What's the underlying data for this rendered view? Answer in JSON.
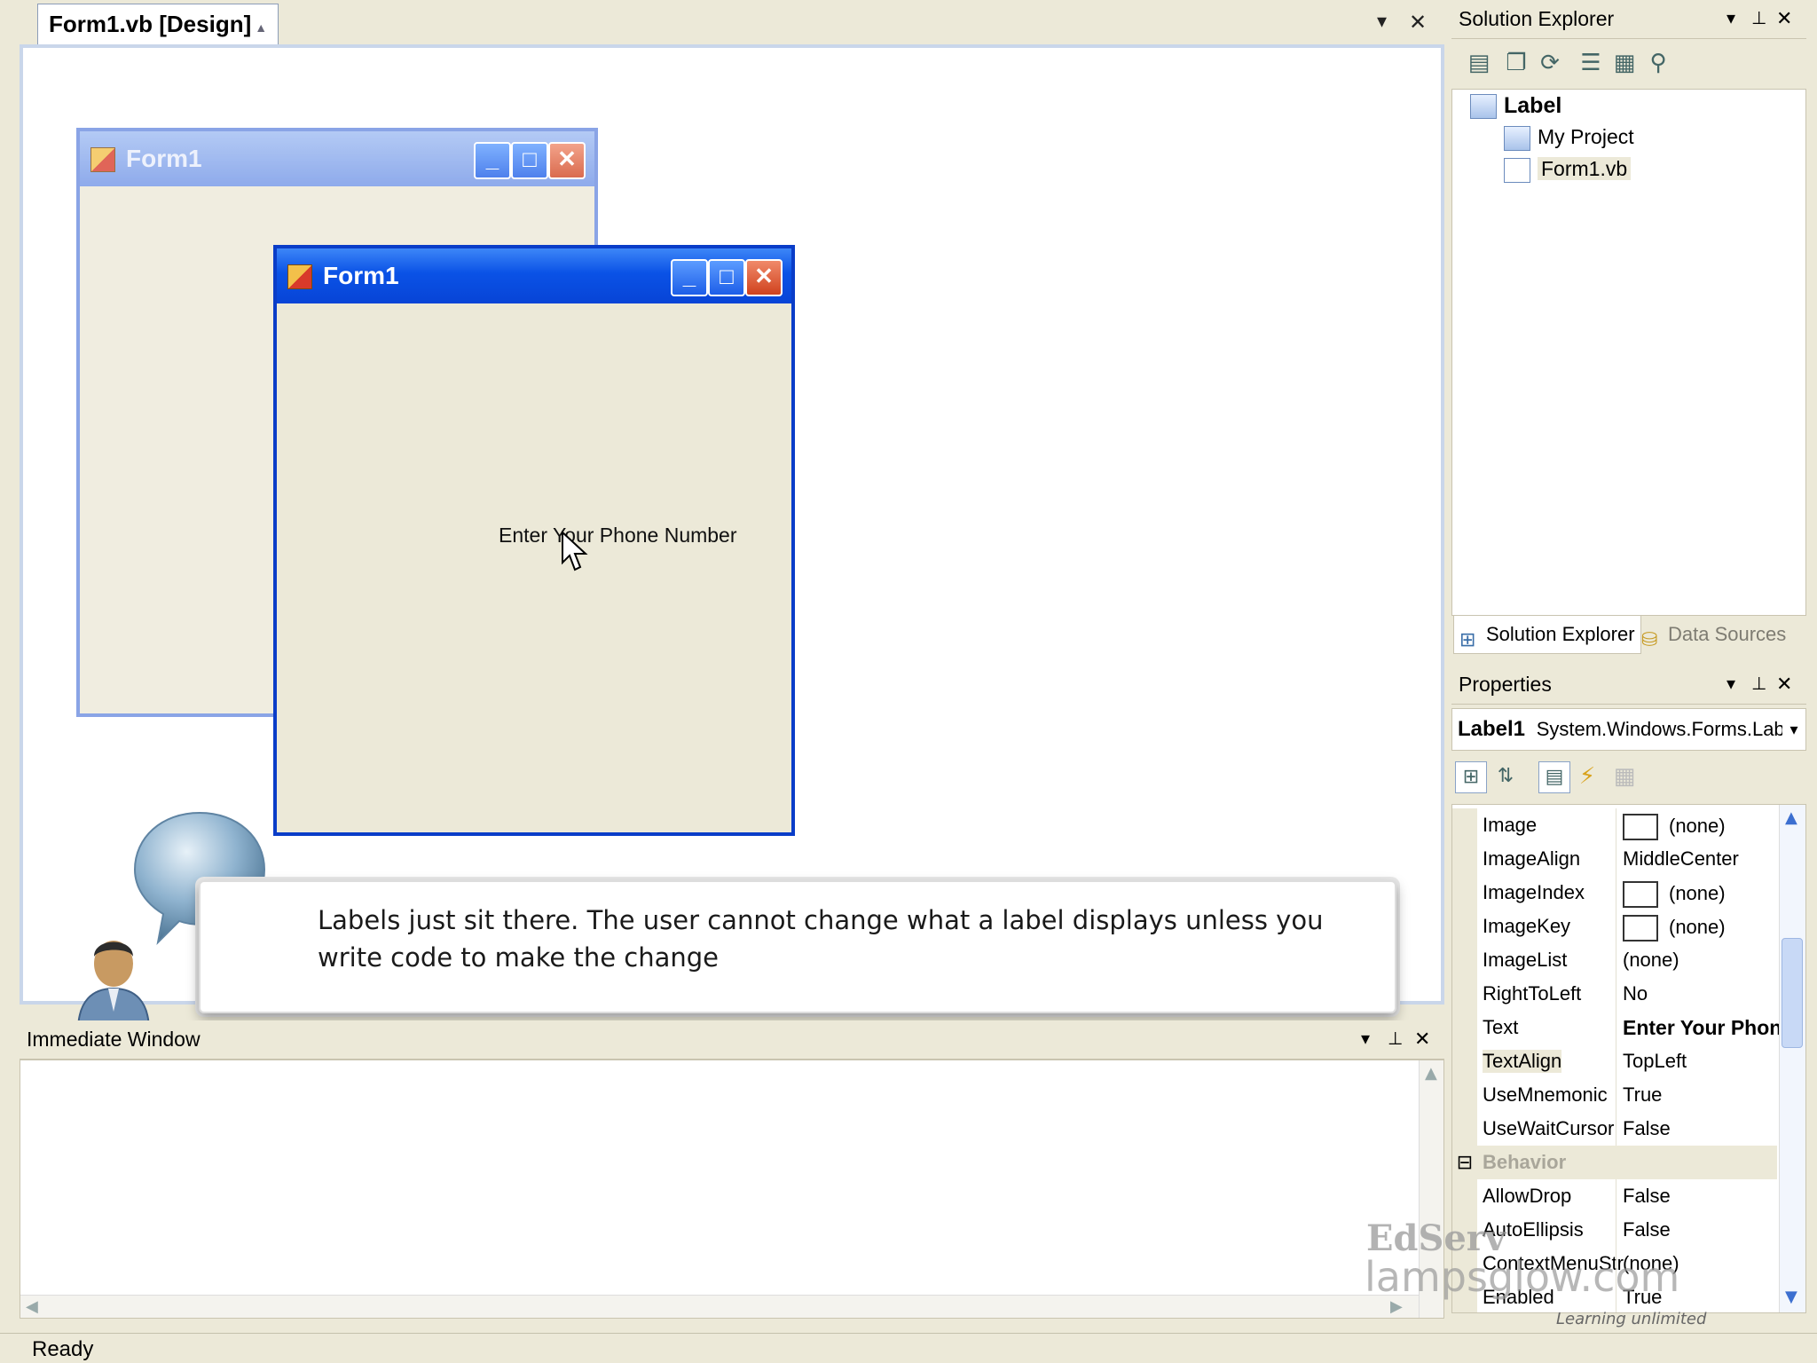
{
  "document": {
    "tab_title": "Form1.vb [Design]",
    "pin_glyph": "▲",
    "dropdown_glyph": "▾",
    "close_glyph": "✕"
  },
  "forms": {
    "back_title": "Form1",
    "front_title": "Form1",
    "label_text": "Enter Your Phone Number",
    "minimize_glyph": "_",
    "maximize_glyph": "□",
    "close_glyph": "✕"
  },
  "callout": {
    "text": "Labels just sit there. The user cannot change what a label displays unless you write code to make the change"
  },
  "immediate_window": {
    "title": "Immediate Window"
  },
  "status": {
    "text": "Ready"
  },
  "solution_explorer": {
    "title": "Solution Explorer",
    "toolbar_icons": [
      "properties-icon",
      "show-all-files-icon",
      "refresh-icon",
      "view-code-icon",
      "view-designer-icon",
      "class-diagram-icon"
    ],
    "tree": [
      {
        "label": "Label",
        "level": 0
      },
      {
        "label": "My Project",
        "level": 1
      },
      {
        "label": "Form1.vb",
        "level": 1
      }
    ],
    "tabs": [
      "Solution Explorer",
      "Data Sources"
    ]
  },
  "properties": {
    "title": "Properties",
    "object_name": "Label1",
    "object_type": "System.Windows.Forms.Label",
    "rows": [
      {
        "name": "Image",
        "value": "(none)",
        "swatch": true
      },
      {
        "name": "ImageAlign",
        "value": "MiddleCenter"
      },
      {
        "name": "ImageIndex",
        "value": "(none)",
        "swatch": true
      },
      {
        "name": "ImageKey",
        "value": "(none)",
        "swatch": true
      },
      {
        "name": "ImageList",
        "value": "(none)"
      },
      {
        "name": "RightToLeft",
        "value": "No"
      },
      {
        "name": "Text",
        "value": "Enter Your Phone Number",
        "bold": true
      },
      {
        "name": "TextAlign",
        "value": "TopLeft",
        "selected": true
      },
      {
        "name": "UseMnemonic",
        "value": "True"
      },
      {
        "name": "UseWaitCursor",
        "value": "False"
      },
      {
        "name": "Behavior",
        "value": "",
        "category": true
      },
      {
        "name": "AllowDrop",
        "value": "False"
      },
      {
        "name": "AutoEllipsis",
        "value": "False"
      },
      {
        "name": "ContextMenuStr",
        "value": "(none)"
      },
      {
        "name": "Enabled",
        "value": "True"
      }
    ]
  },
  "watermark": {
    "line1": "EdServ",
    "line2": "lampsglow.com",
    "line3": "Learning unlimited"
  },
  "colors": {
    "xp_title_blue": "#0a52e6",
    "control_face": "#ece9d8"
  }
}
